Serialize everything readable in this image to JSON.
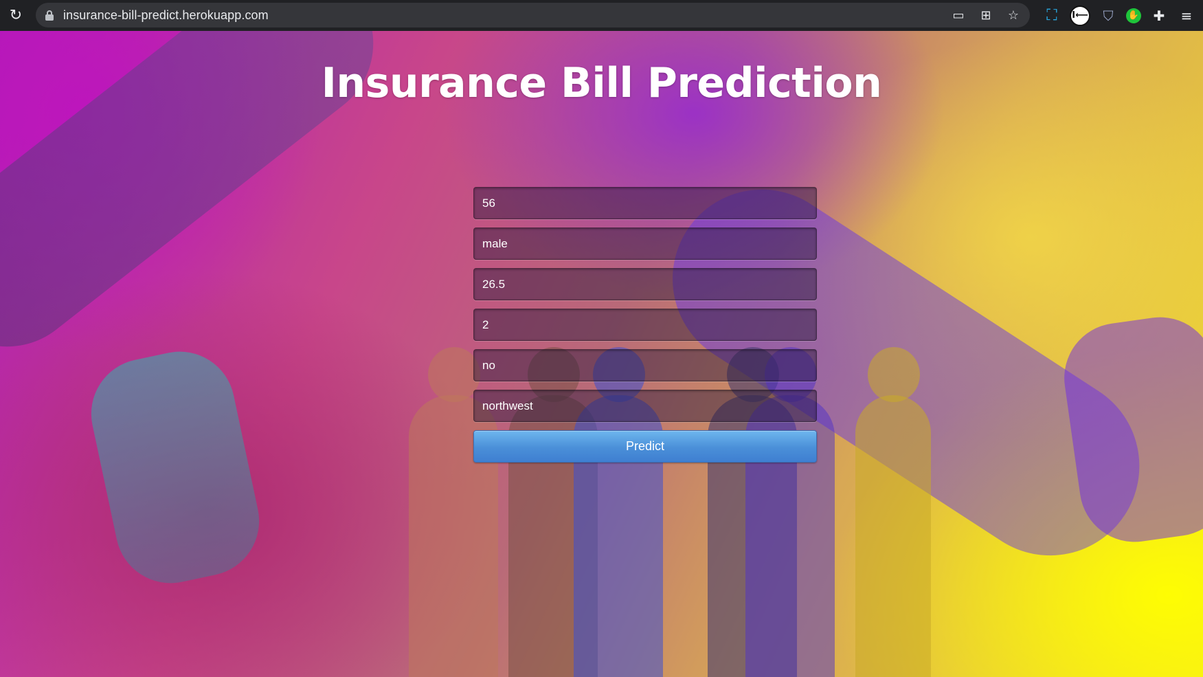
{
  "browser": {
    "url": "insurance-bill-predict.herokuapp.com",
    "icons": [
      "reload-icon",
      "lock-icon",
      "cast-icon",
      "apps-icon",
      "star-icon"
    ],
    "extensions": [
      "screen-capture-icon",
      "extension-dark-icon",
      "shield-icon",
      "green-extension-icon",
      "puzzle-icon",
      "reading-list-icon"
    ]
  },
  "page": {
    "title": "Insurance Bill Prediction",
    "form": {
      "fields": [
        "56",
        "male",
        "26.5",
        "2",
        "no",
        "northwest"
      ],
      "submit_label": "Predict"
    }
  }
}
